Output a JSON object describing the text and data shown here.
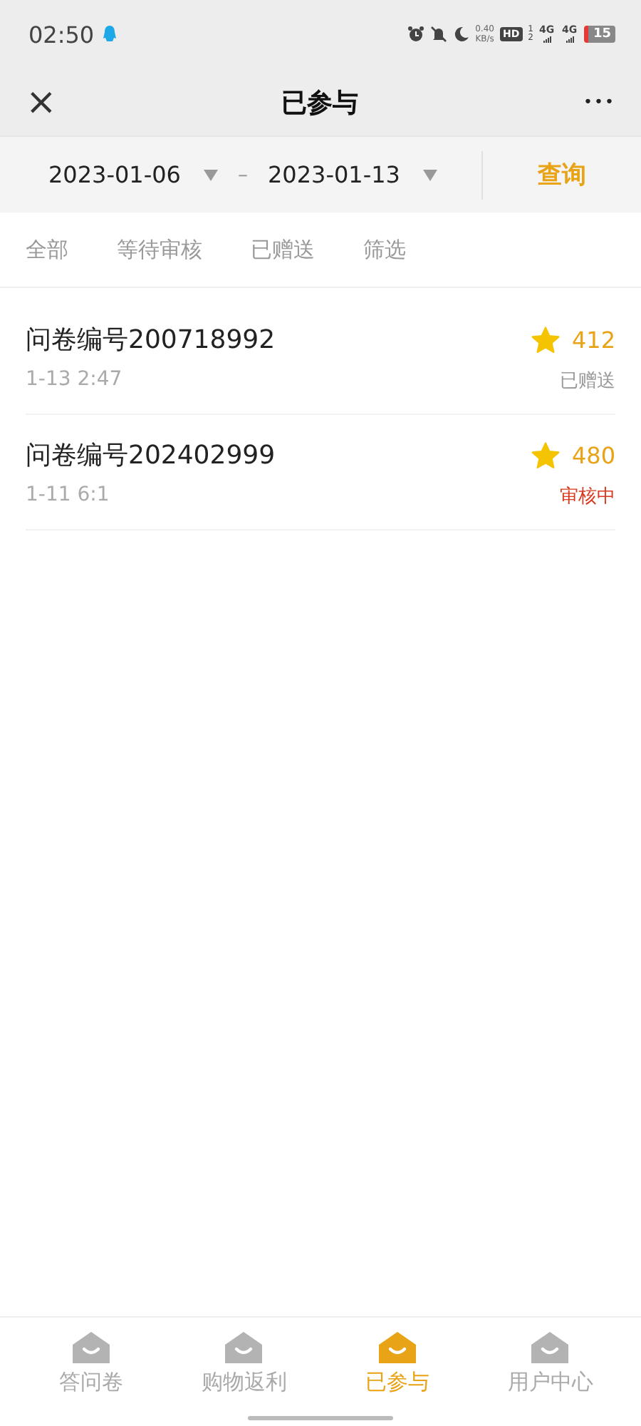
{
  "status_bar": {
    "time": "02:50",
    "net_speed": [
      "0.40",
      "KB/s"
    ],
    "hd": "HD",
    "hd_slots": [
      "1",
      "2"
    ],
    "signals": [
      "4G",
      "4G"
    ],
    "battery": "15"
  },
  "header": {
    "close": "×",
    "title": "已参与",
    "more": "•••"
  },
  "date_range": {
    "start": "2023-01-06",
    "separator": "–",
    "end": "2023-01-13",
    "query_button": "查询"
  },
  "filter_tabs": [
    {
      "label": "全部",
      "selected": false
    },
    {
      "label": "等待审核",
      "selected": false
    },
    {
      "label": "已赠送",
      "selected": false
    },
    {
      "label": "筛选",
      "selected": false
    }
  ],
  "records": [
    {
      "title": "问卷编号200718992",
      "time": "1-13 2:47",
      "points": "412",
      "status": "已赠送",
      "color": "#999999"
    },
    {
      "title": "问卷编号202402999",
      "time": "1-11 6:1",
      "points": "480",
      "status": "审核中",
      "color": "#d9381e"
    }
  ],
  "tab_bar": [
    {
      "label": "答问卷",
      "selected": false
    },
    {
      "label": "购物返利",
      "selected": false
    },
    {
      "label": "已参与",
      "selected": true
    },
    {
      "label": "用户中心",
      "selected": false
    }
  ]
}
